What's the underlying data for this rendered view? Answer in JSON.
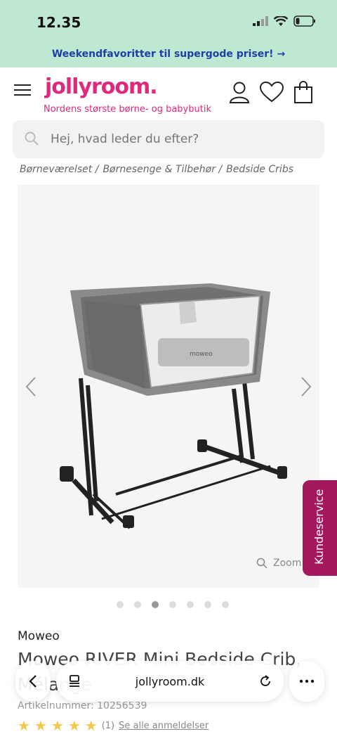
{
  "status": {
    "time": "12.35"
  },
  "promo": {
    "text": "Weekendfavoritter til supergode priser! →"
  },
  "header": {
    "logo": "jollyroom.",
    "tagline": "Nordens største børne- og babybutik"
  },
  "search": {
    "placeholder": "Hej, hvad leder du efter?"
  },
  "breadcrumb": [
    "Børneværelset /",
    "Børnesenge & Tilbehør /",
    "Bedside Cribs"
  ],
  "gallery": {
    "zoom_label": "Zoom",
    "dots_count": 7,
    "active_dot": 2
  },
  "kundeservice": {
    "label": "Kundeservice"
  },
  "product": {
    "brand": "Moweo",
    "title": "Moweo RIVER Mini Bedside Crib, Mélange",
    "article_label": "Artikelnummer:",
    "article_number": "10256539",
    "rating_count": "(1)",
    "reviews_link": "Se alle anmeldelser",
    "stars": 5
  },
  "browser": {
    "url": "jollyroom.dk"
  },
  "colors": {
    "brand_pink": "#e0287d",
    "promo_bg": "#bfe8d2",
    "kundeservice_bg": "#a3175c"
  }
}
